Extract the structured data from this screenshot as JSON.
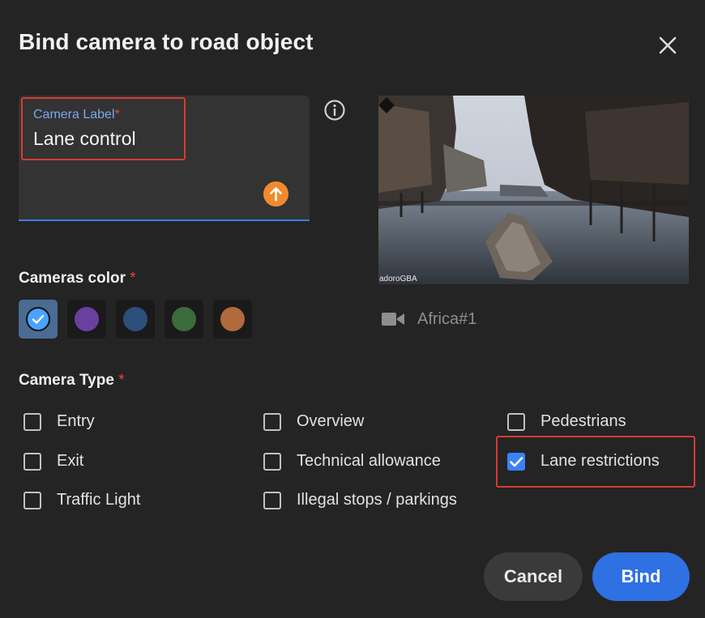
{
  "dialog": {
    "title": "Bind camera to road object"
  },
  "label_field": {
    "label": "Camera Label",
    "required_mark": "*",
    "value": "Lane control"
  },
  "preview": {
    "watermark": "adoroGBA",
    "camera_name": "Africa#1"
  },
  "colors": {
    "title": "Cameras color",
    "required_mark": "*",
    "swatches": [
      {
        "color": "#4aa3ff",
        "selected": true
      },
      {
        "color": "#6b3fa0",
        "selected": false
      },
      {
        "color": "#2c4f7c",
        "selected": false
      },
      {
        "color": "#3c6b3c",
        "selected": false
      },
      {
        "color": "#b06a3c",
        "selected": false
      }
    ]
  },
  "camera_type": {
    "title": "Camera Type",
    "required_mark": "*",
    "options": [
      {
        "label": "Entry",
        "checked": false
      },
      {
        "label": "Exit",
        "checked": false
      },
      {
        "label": "Traffic Light",
        "checked": false
      },
      {
        "label": "Overview",
        "checked": false
      },
      {
        "label": "Technical allowance",
        "checked": false
      },
      {
        "label": "Illegal stops / parkings",
        "checked": false
      },
      {
        "label": "Pedestrians",
        "checked": false
      },
      {
        "label": "Lane restrictions",
        "checked": true
      }
    ]
  },
  "actions": {
    "cancel_label": "Cancel",
    "bind_label": "Bind"
  },
  "theme": {
    "accent": "#2f70e3",
    "upload": "#f18a2c",
    "highlight": "#d83b33"
  }
}
